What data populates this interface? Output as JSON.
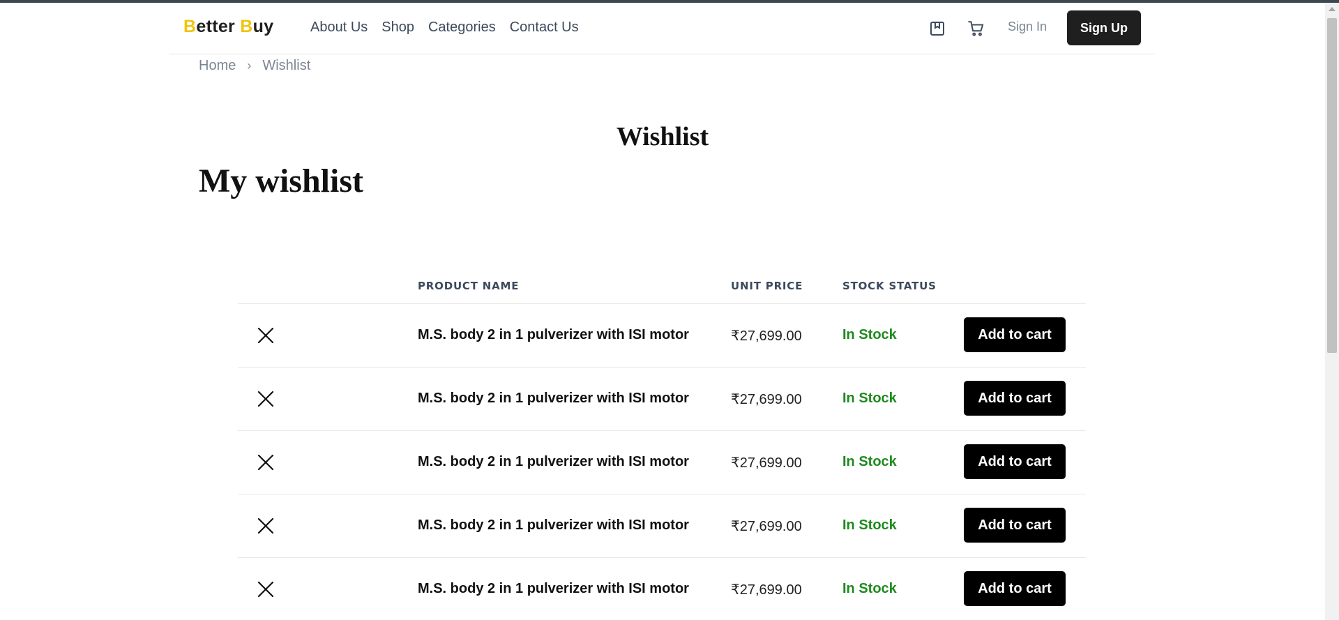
{
  "brand": {
    "first_letter": "B",
    "rest1": "etter ",
    "second_letter": "B",
    "rest2": "uy"
  },
  "nav": [
    {
      "label": "About Us"
    },
    {
      "label": "Shop"
    },
    {
      "label": "Categories"
    },
    {
      "label": "Contact Us"
    }
  ],
  "header": {
    "icons": [
      "bookmark-icon",
      "cart-icon"
    ],
    "signin_label": "Sign In",
    "signup_label": "Sign Up"
  },
  "breadcrumb": {
    "home": "Home",
    "separator": "›",
    "current": "Wishlist"
  },
  "page_title": "Wishlist",
  "section_title": "My wishlist",
  "table": {
    "headers": {
      "product": "PRODUCT NAME",
      "price": "UNIT PRICE",
      "stock": "STOCK STATUS"
    },
    "rows": [
      {
        "name": "M.S. body 2 in 1 pulverizer with ISI motor",
        "price": "₹27,699.00",
        "stock": "In Stock",
        "action": "Add to cart"
      },
      {
        "name": "M.S. body 2 in 1 pulverizer with ISI motor",
        "price": "₹27,699.00",
        "stock": "In Stock",
        "action": "Add to cart"
      },
      {
        "name": "M.S. body 2 in 1 pulverizer with ISI motor",
        "price": "₹27,699.00",
        "stock": "In Stock",
        "action": "Add to cart"
      },
      {
        "name": "M.S. body 2 in 1 pulverizer with ISI motor",
        "price": "₹27,699.00",
        "stock": "In Stock",
        "action": "Add to cart"
      },
      {
        "name": "M.S. body 2 in 1 pulverizer with ISI motor",
        "price": "₹27,699.00",
        "stock": "In Stock",
        "action": "Add to cart"
      }
    ]
  },
  "colors": {
    "brand_accent": "#f1c40f",
    "in_stock": "#1e8a1e",
    "button_dark": "#000000"
  }
}
